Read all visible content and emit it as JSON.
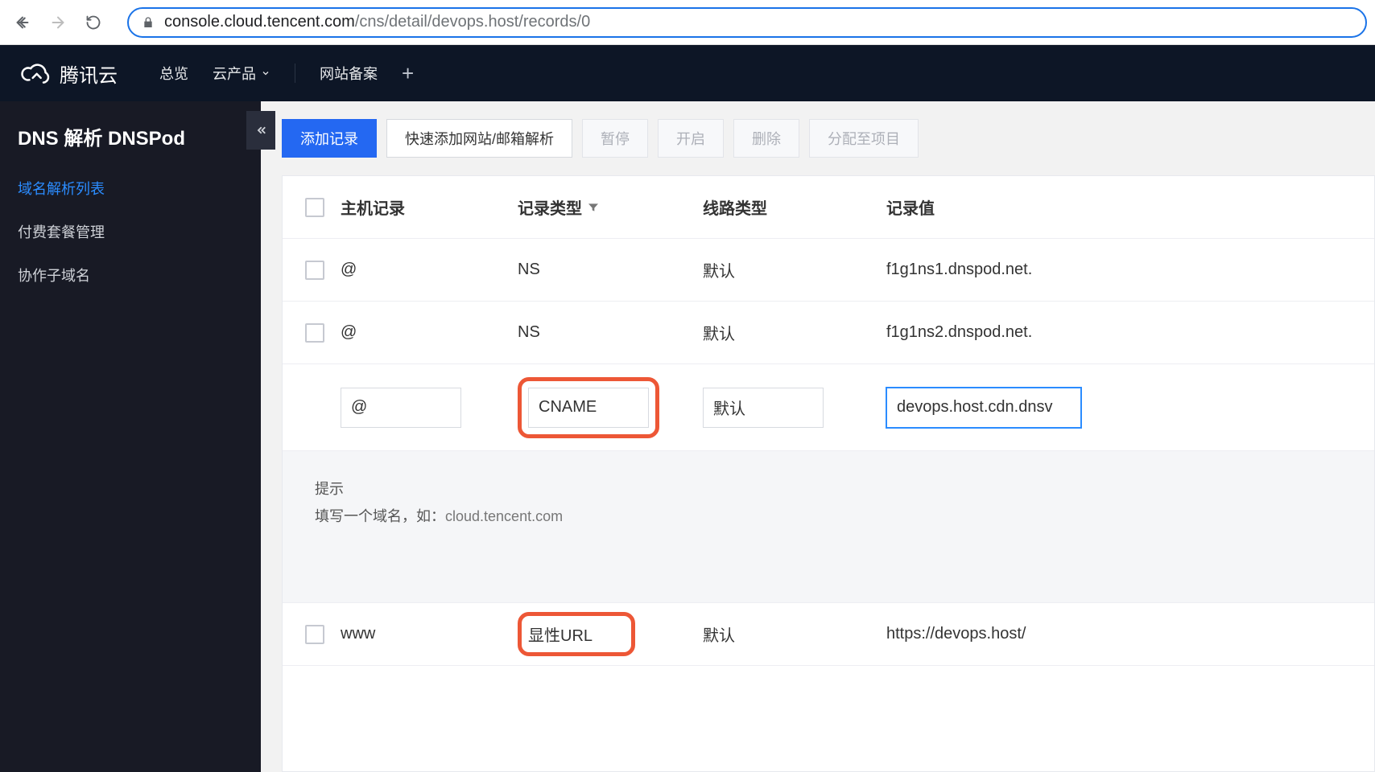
{
  "browser": {
    "url_host": "console.cloud.tencent.com",
    "url_path": "/cns/detail/devops.host/records/0"
  },
  "header": {
    "brand": "腾讯云",
    "menu": {
      "overview": "总览",
      "products": "云产品",
      "beian": "网站备案"
    }
  },
  "sidebar": {
    "title": "DNS 解析 DNSPod",
    "items": [
      {
        "label": "域名解析列表",
        "active": true
      },
      {
        "label": "付费套餐管理",
        "active": false
      },
      {
        "label": "协作子域名",
        "active": false
      }
    ]
  },
  "toolbar": {
    "add": "添加记录",
    "quick": "快速添加网站/邮箱解析",
    "pause": "暂停",
    "enable": "开启",
    "delete": "删除",
    "assign": "分配至项目"
  },
  "table": {
    "headers": {
      "host": "主机记录",
      "type": "记录类型",
      "line": "线路类型",
      "value": "记录值"
    },
    "rows": [
      {
        "host": "@",
        "type": "NS",
        "line": "默认",
        "value": "f1g1ns1.dnspod.net."
      },
      {
        "host": "@",
        "type": "NS",
        "line": "默认",
        "value": "f1g1ns2.dnspod.net."
      }
    ],
    "edit": {
      "host": "@",
      "type": "CNAME",
      "line": "默认",
      "value": "devops.host.cdn.dnsv"
    },
    "last": {
      "host": "www",
      "type": "显性URL",
      "line": "默认",
      "value": "https://devops.host/"
    }
  },
  "hint": {
    "title": "提示",
    "body_prefix": "填写一个域名，如：",
    "body_example": "cloud.tencent.com"
  }
}
